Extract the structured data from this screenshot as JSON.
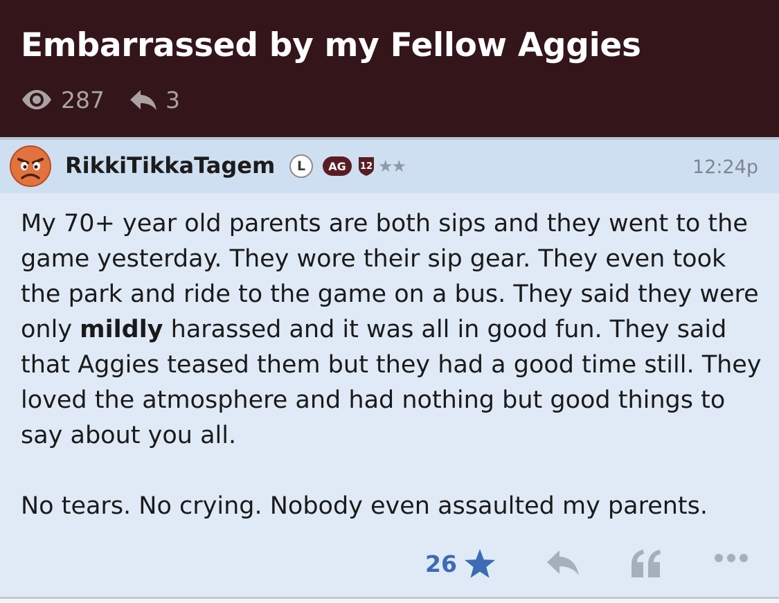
{
  "thread": {
    "title": "Embarrassed by my Fellow Aggies",
    "views": "287",
    "replies": "3"
  },
  "post": {
    "username": "RikkiTikkaTagem",
    "badges": {
      "l": "L",
      "ag": "AG",
      "number": "12",
      "stars": "★★"
    },
    "timestamp": "12:24p",
    "paragraph1": {
      "before": "My 70+ year old parents are both sips and they went to the game yesterday. They wore their sip gear. They even took the park and ride to the game on a bus. They said they were only ",
      "bold": "mildly",
      "after": " harassed and it was all in good fun. They said that Aggies teased them but they had a good time still. They loved the atmosphere and had nothing but good things to say about you all."
    },
    "paragraph2": "No tears. No crying. Nobody even assaulted my parents.",
    "likes": "26"
  },
  "colors": {
    "header_bg": "#341519",
    "post_header_bg": "#cfdff2",
    "post_bg": "#dfeaf6",
    "like_blue": "#3d6bb4",
    "ag_badge": "#5a1c22"
  },
  "icons": {
    "views": "eye-icon",
    "replies": "reply-icon",
    "avatar": "angry-face-avatar",
    "like": "star-icon",
    "reply_action": "reply-icon",
    "quote_action": "quote-icon",
    "more_action": "more-icon"
  }
}
